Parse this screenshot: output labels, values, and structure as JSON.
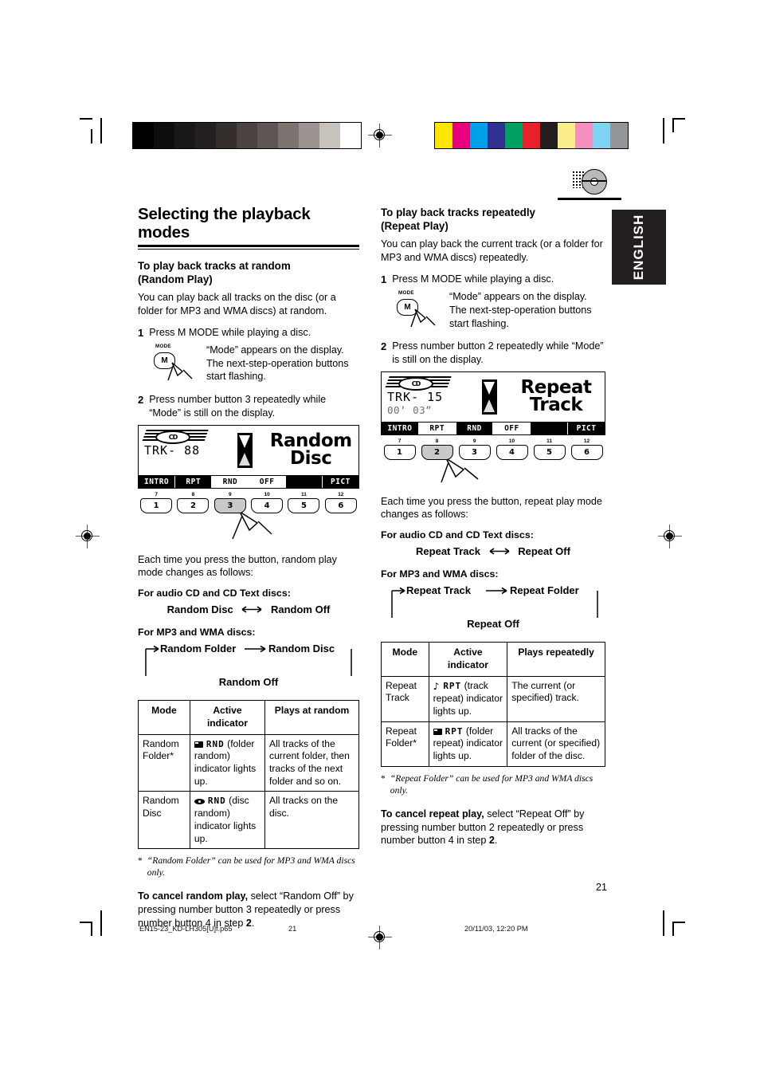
{
  "document": {
    "page_number": "21",
    "language_tab": "ENGLISH"
  },
  "printer_marks": {
    "grayscale_steps": [
      "#000000",
      "#0e0c0c",
      "#1a1718",
      "#241f20",
      "#332d2c",
      "#4a4342",
      "#5f5654",
      "#7b736f",
      "#9c9490",
      "#c8c2bd",
      "#ffffff"
    ],
    "color_swatches": [
      "#ffe600",
      "#e6007e",
      "#00a0e9",
      "#2e3192",
      "#00a160",
      "#e8202a",
      "#231f20",
      "#fbee8a",
      "#f48fc0",
      "#7fd4f4",
      "#939598"
    ]
  },
  "left": {
    "section_title": "Selecting the playback modes",
    "heading": "To play back tracks at random\n(Random Play)",
    "heading_line1": "To play back tracks at random",
    "heading_line2": "(Random Play)",
    "intro": "You can play back all tracks on the disc (or a folder for MP3 and WMA discs) at random.",
    "step1": {
      "number": "1",
      "text": "Press M MODE while playing a disc.",
      "button_label": "MODE",
      "button_key": "M",
      "note": "“Mode” appears on the display. The next-step-operation buttons start flashing."
    },
    "step2": {
      "number": "2",
      "text": "Press number button 3 repeatedly while “Mode” is still on the display."
    },
    "lcd": {
      "logo": "CD",
      "track_label": "TRK-",
      "track_value": "88",
      "time_value": "",
      "message_line1": "Random",
      "message_line2": "Disc",
      "bar": [
        {
          "label": "INTRO",
          "inverted": false
        },
        {
          "label": "RPT",
          "inverted": false
        },
        {
          "label": "RND",
          "inverted": true
        },
        {
          "label": "OFF",
          "inverted": true
        },
        {
          "label": "",
          "inverted": false
        },
        {
          "label": "PICT",
          "inverted": false
        }
      ]
    },
    "number_buttons": [
      {
        "small": "7",
        "key": "1",
        "pressed": false
      },
      {
        "small": "8",
        "key": "2",
        "pressed": false
      },
      {
        "small": "9",
        "key": "3",
        "pressed": true
      },
      {
        "small": "10",
        "key": "4",
        "pressed": false
      },
      {
        "small": "11",
        "key": "5",
        "pressed": false
      },
      {
        "small": "12",
        "key": "6",
        "pressed": false
      }
    ],
    "flow_lead": "Each time you press the button, random play mode changes as follows:",
    "flow_cd_head": "For audio CD and CD Text discs:",
    "flow_cd_a": "Random Disc",
    "flow_cd_b": "Random Off",
    "flow_mp3_head": "For MP3 and WMA discs:",
    "flow_mp3_a": "Random Folder",
    "flow_mp3_b": "Random Disc",
    "flow_mp3_c": "Random Off",
    "table": {
      "headers": [
        "Mode",
        "Active indicator",
        "Plays at random"
      ],
      "header_active_line1": "Active",
      "header_active_line2": "indicator",
      "rows": [
        {
          "mode": "Random Folder*",
          "indicator_icon": "folder-icon",
          "indicator_code": "RND",
          "indicator_text": "(folder random) indicator lights up.",
          "plays": "All tracks of the current folder, then tracks of the next folder and so on."
        },
        {
          "mode": "Random Disc",
          "indicator_icon": "disc-icon",
          "indicator_code": "RND",
          "indicator_text": "(disc random) indicator lights up.",
          "plays": "All tracks on the disc."
        }
      ]
    },
    "footnote": "“Random Folder”  can be used for MP3 and WMA discs only.",
    "footnote_star": "*",
    "cancel_bold": "To cancel random play,",
    "cancel_rest": " select “Random Off” by pressing number button 3 repeatedly or press number button 4 in step ",
    "cancel_step": "2",
    "cancel_end": "."
  },
  "right": {
    "heading_line1": "To play back tracks repeatedly",
    "heading_line2": "(Repeat Play)",
    "intro": "You can play back the current track (or a folder for MP3 and WMA discs) repeatedly.",
    "step1": {
      "number": "1",
      "text": "Press M MODE while playing a disc.",
      "button_label": "MODE",
      "button_key": "M",
      "note": "“Mode” appears on the display. The next-step-operation buttons start flashing."
    },
    "step2": {
      "number": "2",
      "text": "Press number button 2 repeatedly while “Mode” is still on the display."
    },
    "lcd": {
      "logo": "CD",
      "track_label": "TRK-",
      "track_value": "15",
      "time_value": "00’ 03”",
      "message_line1": "Repeat",
      "message_line2": "Track",
      "bar": [
        {
          "label": "INTRO",
          "inverted": false
        },
        {
          "label": "RPT",
          "inverted": true
        },
        {
          "label": "RND",
          "inverted": false
        },
        {
          "label": "OFF",
          "inverted": true
        },
        {
          "label": "",
          "inverted": false
        },
        {
          "label": "PICT",
          "inverted": false
        }
      ]
    },
    "number_buttons": [
      {
        "small": "7",
        "key": "1",
        "pressed": false
      },
      {
        "small": "8",
        "key": "2",
        "pressed": true
      },
      {
        "small": "9",
        "key": "3",
        "pressed": false
      },
      {
        "small": "10",
        "key": "4",
        "pressed": false
      },
      {
        "small": "11",
        "key": "5",
        "pressed": false
      },
      {
        "small": "12",
        "key": "6",
        "pressed": false
      }
    ],
    "flow_lead": "Each time you press the button, repeat play mode changes as follows:",
    "flow_cd_head": "For audio CD and CD Text discs:",
    "flow_cd_a": "Repeat Track",
    "flow_cd_b": "Repeat Off",
    "flow_mp3_head": "For MP3 and WMA discs:",
    "flow_mp3_a": "Repeat Track",
    "flow_mp3_b": "Repeat Folder",
    "flow_mp3_c": "Repeat Off",
    "table": {
      "headers": [
        "Mode",
        "Active indicator",
        "Plays repeatedly"
      ],
      "header_active_line1": "Active",
      "header_active_line2": "indicator",
      "rows": [
        {
          "mode": "Repeat Track",
          "indicator_icon": "note-icon",
          "indicator_code": "RPT",
          "indicator_text": "(track repeat) indicator lights up.",
          "plays": "The current (or specified) track."
        },
        {
          "mode": "Repeat Folder*",
          "indicator_icon": "folder-icon",
          "indicator_code": "RPT",
          "indicator_text": "(folder repeat) indicator lights up.",
          "plays": "All tracks of the current (or specified) folder of the disc."
        }
      ]
    },
    "footnote": "“Repeat Folder”  can be used for MP3 and WMA discs only.",
    "footnote_star": "*",
    "cancel_bold": "To cancel repeat play,",
    "cancel_rest": " select “Repeat Off” by pressing number button 2 repeatedly or press number button 4 in step ",
    "cancel_step": "2",
    "cancel_end": "."
  },
  "footer": {
    "filename": "EN15-23_KD-LH305[U]f.p65",
    "page": "21",
    "timestamp": "20/11/03, 12:20 PM"
  }
}
